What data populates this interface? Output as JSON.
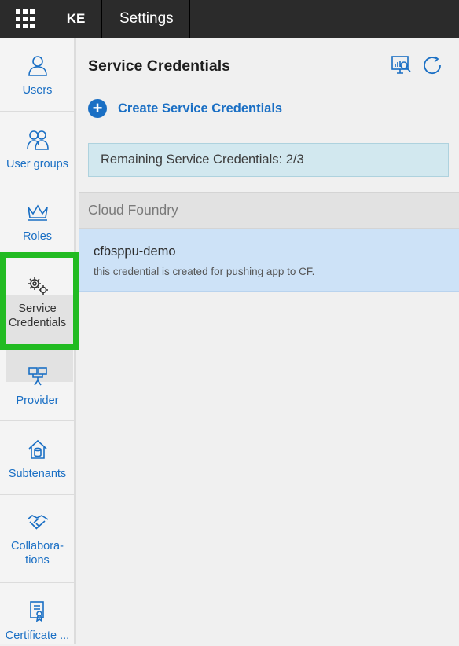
{
  "header": {
    "tenant": "KE",
    "title": "Settings",
    "app_menu_icon": "app-grid-icon"
  },
  "sidebar": {
    "items": [
      {
        "label": "Users",
        "icon": "user-icon"
      },
      {
        "label": "User groups",
        "icon": "user-group-icon"
      },
      {
        "label": "Roles",
        "icon": "crown-icon"
      },
      {
        "label": "Service Credentials",
        "icon": "gears-key-icon",
        "active": true
      },
      {
        "label": "Provider",
        "icon": "provider-icon"
      },
      {
        "label": "Subtenants",
        "icon": "house-database-icon"
      },
      {
        "label": "Collabora-tions",
        "icon": "handshake-icon"
      },
      {
        "label": "Certificate ...",
        "icon": "certificate-icon"
      }
    ]
  },
  "main": {
    "title": "Service Credentials",
    "toolbar_icons": [
      "monitor-search-icon",
      "refresh-icon"
    ],
    "create_label": "Create Service Credentials",
    "remaining_text": "Remaining Service Credentials: 2/3",
    "group_header": "Cloud Foundry",
    "credentials": [
      {
        "name": "cfbsppu-demo",
        "description": "this credential is created for pushing app to CF."
      }
    ]
  },
  "colors": {
    "topbar": "#2b2b2b",
    "accent": "#1a6fc4",
    "info_bg": "#d2e8ef",
    "selected_row": "#cde2f7",
    "highlight": "#22bb22"
  }
}
